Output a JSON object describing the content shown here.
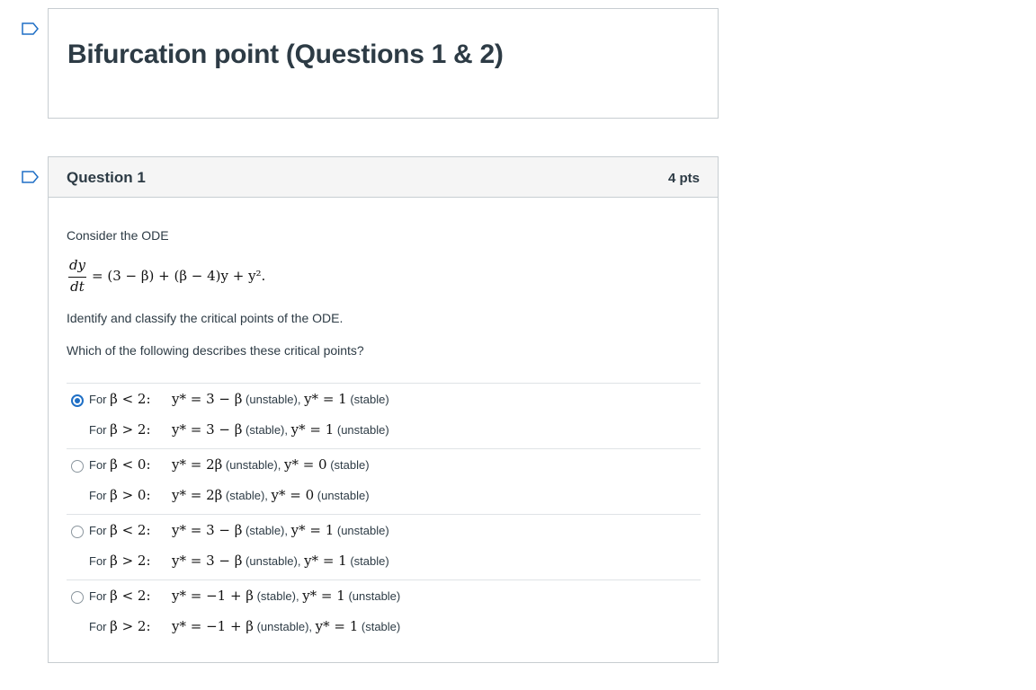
{
  "header": {
    "title": "Bifurcation point (Questions 1 & 2)"
  },
  "question": {
    "title": "Question 1",
    "points": "4 pts",
    "intro": "Consider the ODE",
    "equation": {
      "num": "dy",
      "den": "dt",
      "rhs": "= (3 − β) + (β − 4)y + y²."
    },
    "prompt1": "Identify and classify the critical points of the ODE.",
    "prompt2": "Which of the following describes these critical points?"
  },
  "answers": [
    {
      "selected": true,
      "line1": {
        "for": "For",
        "cond": "β < 2:",
        "e1": "y* = 3 − β",
        "s1": "(unstable),",
        "e2": "y* = 1",
        "s2": "(stable)"
      },
      "line2": {
        "for": "For",
        "cond": "β > 2:",
        "e1": "y* = 3 − β",
        "s1": "(stable),",
        "e2": "y* = 1",
        "s2": "(unstable)"
      }
    },
    {
      "selected": false,
      "line1": {
        "for": "For",
        "cond": "β < 0:",
        "e1": "y* = 2β",
        "s1": "(unstable),",
        "e2": "y* = 0",
        "s2": "(stable)"
      },
      "line2": {
        "for": "For",
        "cond": "β > 0:",
        "e1": "y* = 2β",
        "s1": "(stable),",
        "e2": "y* = 0",
        "s2": "(unstable)"
      }
    },
    {
      "selected": false,
      "line1": {
        "for": "For",
        "cond": "β < 2:",
        "e1": "y* = 3 − β",
        "s1": "(stable),",
        "e2": "y* = 1",
        "s2": "(unstable)"
      },
      "line2": {
        "for": "For",
        "cond": "β > 2:",
        "e1": "y* = 3 − β",
        "s1": "(unstable),",
        "e2": "y* = 1",
        "s2": "(stable)"
      }
    },
    {
      "selected": false,
      "line1": {
        "for": "For",
        "cond": "β < 2:",
        "e1": "y* = −1 + β",
        "s1": "(stable),",
        "e2": "y* = 1",
        "s2": "(unstable)"
      },
      "line2": {
        "for": "For",
        "cond": "β > 2:",
        "e1": "y* = −1 + β",
        "s1": "(unstable),",
        "e2": "y* = 1",
        "s2": "(stable)"
      }
    }
  ],
  "colors": {
    "accent": "#1f6fc5",
    "border": "#c7cdd1",
    "header_bg": "#f5f5f5",
    "text": "#2d3b45"
  }
}
